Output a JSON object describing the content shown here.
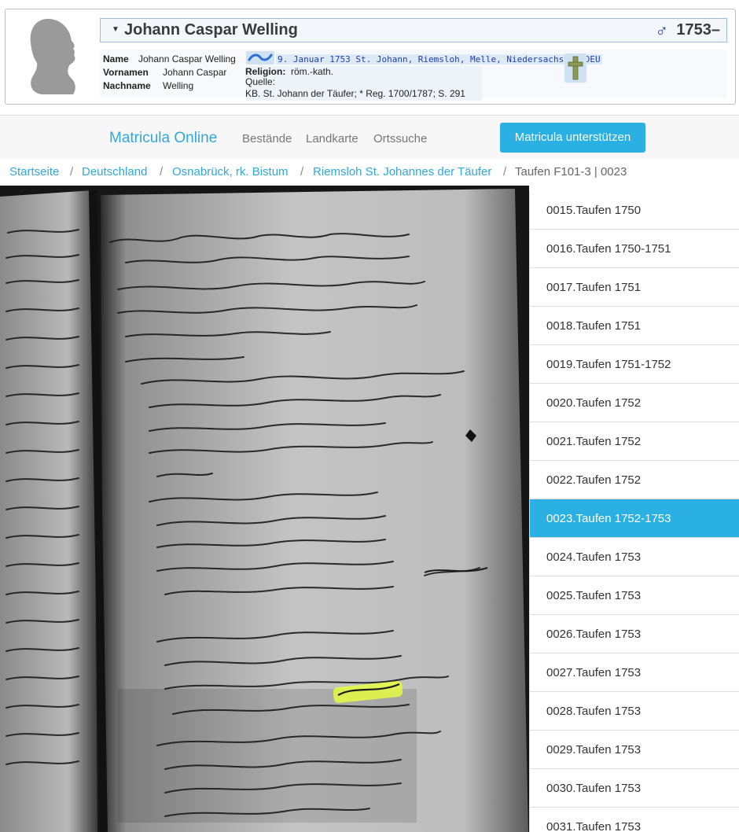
{
  "person": {
    "title_name": "Johann Caspar Welling",
    "gender_symbol": "♂",
    "years": "1753–",
    "name_label": "Name",
    "name_value": "Johann Caspar Welling",
    "vornamen_label": "Vornamen",
    "vornamen_value": "Johann Caspar",
    "nachname_label": "Nachname",
    "nachname_value": "Welling",
    "baptism_symbol": "~",
    "baptism_text": "9. Januar 1753 St. Johann, Riemsloh, Melle, Niedersachsen, DEU",
    "religion_label": "Religion:",
    "religion_value": "röm.-kath.",
    "quelle_label": "Quelle:",
    "quelle_value": "KB. St. Johann der Täufer; * Reg. 1700/1787; S. 291"
  },
  "navbar": {
    "brand": "Matricula Online",
    "items": [
      "Bestände",
      "Landkarte",
      "Ortssuche"
    ],
    "support_button": "Matricula unterstützen"
  },
  "breadcrumb": {
    "items": [
      "Startseite",
      "Deutschland",
      "Osnabrück, rk. Bistum",
      "Riemsloh St. Johannes der Täufer"
    ],
    "separator": "/",
    "current": "Taufen F101-3 | 0023"
  },
  "image_list": {
    "items": [
      "0015.Taufen 1750",
      "0016.Taufen 1750-1751",
      "0017.Taufen 1751",
      "0018.Taufen 1751",
      "0019.Taufen 1751-1752",
      "0020.Taufen 1752",
      "0021.Taufen 1752",
      "0022.Taufen 1752",
      "0023.Taufen 1752-1753",
      "0024.Taufen 1753",
      "0025.Taufen 1753",
      "0026.Taufen 1753",
      "0027.Taufen 1753",
      "0028.Taufen 1753",
      "0029.Taufen 1753",
      "0030.Taufen 1753",
      "0031.Taufen 1753"
    ],
    "active_index": 8
  },
  "colors": {
    "accent": "#2ab0e3",
    "brand": "#31a8db",
    "highlight": "#e8ff3a"
  }
}
